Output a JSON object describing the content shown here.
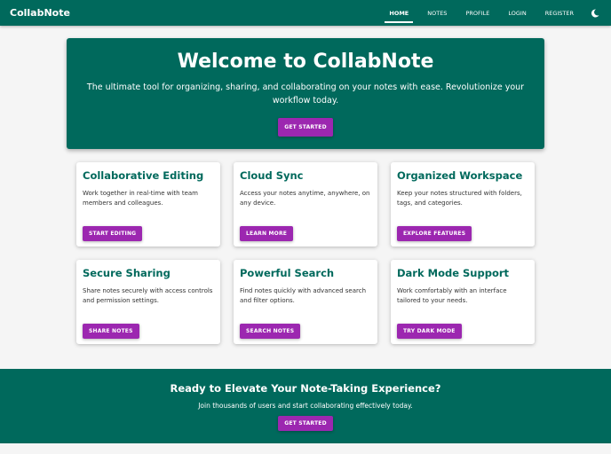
{
  "nav": {
    "brand": "CollabNote",
    "links": [
      "HOME",
      "NOTES",
      "PROFILE",
      "LOGIN",
      "REGISTER"
    ]
  },
  "hero": {
    "title": "Welcome to CollabNote",
    "text": "The ultimate tool for organizing, sharing, and collaborating on your notes with ease. Revolutionize your workflow today.",
    "button": "GET STARTED"
  },
  "features": [
    {
      "title": "Collaborative Editing",
      "text": "Work together in real-time with team members and colleagues.",
      "button": "START EDITING"
    },
    {
      "title": "Cloud Sync",
      "text": "Access your notes anytime, anywhere, on any device.",
      "button": "LEARN MORE"
    },
    {
      "title": "Organized Workspace",
      "text": "Keep your notes structured with folders, tags, and categories.",
      "button": "EXPLORE FEATURES"
    },
    {
      "title": "Secure Sharing",
      "text": "Share notes securely with access controls and permission settings.",
      "button": "SHARE NOTES"
    },
    {
      "title": "Powerful Search",
      "text": "Find notes quickly with advanced search and filter options.",
      "button": "SEARCH NOTES"
    },
    {
      "title": "Dark Mode Support",
      "text": "Work comfortably with an interface tailored to your needs.",
      "button": "TRY DARK MODE"
    }
  ],
  "cta": {
    "title": "Ready to Elevate Your Note-Taking Experience?",
    "text": "Join thousands of users and start collaborating effectively today.",
    "button": "GET STARTED"
  }
}
